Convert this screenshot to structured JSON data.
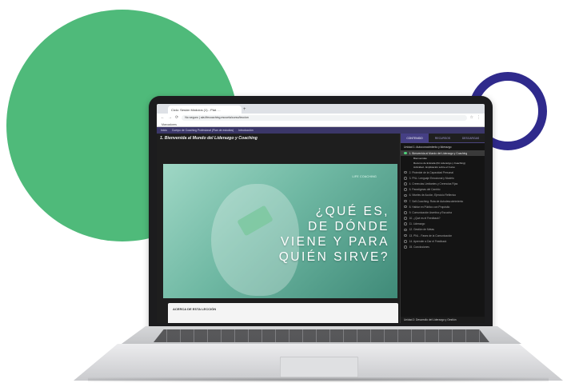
{
  "browser": {
    "tab_title": "Ciclo: Sesión Módulos (1) - Plat. ...",
    "new_tab": "+",
    "url": "No seguro | ala.lifecoaching.escuela/curso/leccion",
    "bookmarks": "Marcadores"
  },
  "site_nav": {
    "items": [
      "Inicio",
      "Cuerpo de Coaching Profesional (Plan de estudios)",
      "Introducción"
    ]
  },
  "lesson": {
    "title": "1. Bienvenida al Mundo del Liderazgo y Coaching"
  },
  "video": {
    "logo": "LIFE COACHING",
    "lines": [
      "¿QUÉ ES,",
      "DE DÓNDE",
      "VIENE Y PARA",
      "QUIÉN SIRVE?"
    ]
  },
  "info_box": {
    "title": "ACERCA DE ESTA LECCIÓN"
  },
  "sidebar": {
    "tabs": [
      "CONTENIDO",
      "RECURSOS",
      "DESCARGAS"
    ],
    "active_tab": 0,
    "unit_title": "Unidad 1: Autoconocimiento y liderazgo",
    "lessons": [
      {
        "label": "1. Bienvenida al Mundo del Liderazgo y Coaching",
        "current": true
      },
      {
        "label": "2. Pirámide de la Capacidad Personal",
        "current": false
      },
      {
        "label": "3. PNL: Lenguaje Emocional y Modelo",
        "current": false
      },
      {
        "label": "4. Creencias Limitantes y Creencias Fijas",
        "current": false
      },
      {
        "label": "5. Paradigmas del Cambio",
        "current": false
      },
      {
        "label": "6. Niveles de Acción, Ejercicio Reflexivo",
        "current": false
      },
      {
        "label": "7. Self-Coaching: Ruta de Autodescubrimiento",
        "current": false
      },
      {
        "label": "8. Hablar en Público con Propósito",
        "current": false
      },
      {
        "label": "9. Comunicación Asertiva y Escucha",
        "current": false
      },
      {
        "label": "10. ¿Qué es el Feedback?",
        "current": false
      },
      {
        "label": "11. Liderazgo",
        "current": false
      },
      {
        "label": "12. Gestión de Metas",
        "current": false
      },
      {
        "label": "13. PNL - Fases de la Comunicación",
        "current": false
      },
      {
        "label": "14. Aprender a Dar el Feedback",
        "current": false
      },
      {
        "label": "15. Conclusiones",
        "current": false
      }
    ],
    "sub_items": [
      "Bienvenidas",
      "Recurso de Entrada (Kit Liderazgo y Coaching)",
      "Actividad - Explicación sobre el Curso"
    ],
    "footer": "Unidad 2: Desarrollo del Liderazgo y Gestión"
  },
  "colors": {
    "green_circle": "#4fba7a",
    "ring": "#2f2a8c",
    "accent_purple": "#453f84"
  }
}
